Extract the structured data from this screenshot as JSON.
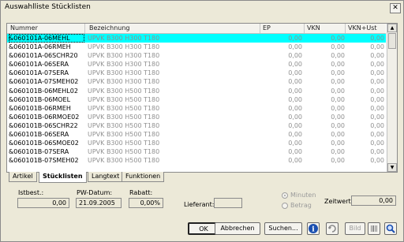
{
  "window": {
    "title": "Auswahlliste Stücklisten",
    "close": "✕"
  },
  "grid": {
    "headers": {
      "nummer": "Nummer",
      "bez": "Bezeichnung",
      "ep": "EP",
      "vkn": "VKN",
      "vkn_ust": "VKN+Ust"
    },
    "rows": [
      {
        "num": "&060101A-06MEHL",
        "bez": "UPVK B300 H300 T180",
        "ep": "0,00",
        "vkn": "0,00",
        "vkn_ust": "0,00"
      },
      {
        "num": "&060101A-06RMEH",
        "bez": "UPVK B300 H300 T180",
        "ep": "0,00",
        "vkn": "0,00",
        "vkn_ust": "0,00"
      },
      {
        "num": "&060101A-06SCHR20",
        "bez": "UPVK B300 H300 T180",
        "ep": "0,00",
        "vkn": "0,00",
        "vkn_ust": "0,00"
      },
      {
        "num": "&060101A-06SERA",
        "bez": "UPVK B300 H300 T180",
        "ep": "0,00",
        "vkn": "0,00",
        "vkn_ust": "0,00"
      },
      {
        "num": "&060101A-07SERA",
        "bez": "UPVK B300 H300 T180",
        "ep": "0,00",
        "vkn": "0,00",
        "vkn_ust": "0,00"
      },
      {
        "num": "&060101A-07SMEH02",
        "bez": "UPVK B300 H300 T180",
        "ep": "0,00",
        "vkn": "0,00",
        "vkn_ust": "0,00"
      },
      {
        "num": "&060101B-06MEHL02",
        "bez": "UPVK B300 H500 T180",
        "ep": "0,00",
        "vkn": "0,00",
        "vkn_ust": "0,00"
      },
      {
        "num": "&060101B-06MOEL",
        "bez": "UPVK B300 H500 T180",
        "ep": "0,00",
        "vkn": "0,00",
        "vkn_ust": "0,00"
      },
      {
        "num": "&060101B-06RMEH",
        "bez": "UPVK B300 H500 T180",
        "ep": "0,00",
        "vkn": "0,00",
        "vkn_ust": "0,00"
      },
      {
        "num": "&060101B-06RMOE02",
        "bez": "UPVK B300 H500 T180",
        "ep": "0,00",
        "vkn": "0,00",
        "vkn_ust": "0,00"
      },
      {
        "num": "&060101B-06SCHR22",
        "bez": "UPVK B300 H500 T180",
        "ep": "0,00",
        "vkn": "0,00",
        "vkn_ust": "0,00"
      },
      {
        "num": "&060101B-06SERA",
        "bez": "UPVK B300 H500 T180",
        "ep": "0,00",
        "vkn": "0,00",
        "vkn_ust": "0,00"
      },
      {
        "num": "&060101B-06SMOE02",
        "bez": "UPVK B300 H500 T180",
        "ep": "0,00",
        "vkn": "0,00",
        "vkn_ust": "0,00"
      },
      {
        "num": "&060101B-07SERA",
        "bez": "UPVK B300 H500 T180",
        "ep": "0,00",
        "vkn": "0,00",
        "vkn_ust": "0,00"
      },
      {
        "num": "&060101B-07SMEH02",
        "bez": "UPVK B300 H500 T180",
        "ep": "0,00",
        "vkn": "0,00",
        "vkn_ust": "0,00"
      }
    ],
    "selected_index": 0
  },
  "tabs": [
    "Artikel",
    "Stücklisten",
    "Langtext",
    "Funktionen"
  ],
  "active_tab": "Stücklisten",
  "footer": {
    "istbest_label": "Istbest.:",
    "istbest_value": "0,00",
    "pwdatum_label": "PW-Datum:",
    "pwdatum_value": "21.09.2005",
    "rabatt_label": "Rabatt:",
    "rabatt_value": "0,00%",
    "lieferant_label": "Lieferant:",
    "lieferant_value": "",
    "radio_minuten": "Minuten",
    "radio_betrag": "Betrag",
    "zeitwert_label": "Zeitwert:",
    "zeitwert_value": "0,00"
  },
  "buttons": {
    "ok": "OK",
    "abbrechen": "Abbrechen",
    "suchen": "Suchen...",
    "bild": "Bild"
  },
  "icons": [
    "info-icon",
    "refresh-icon",
    "barcode-icon",
    "magnifier-icon"
  ]
}
